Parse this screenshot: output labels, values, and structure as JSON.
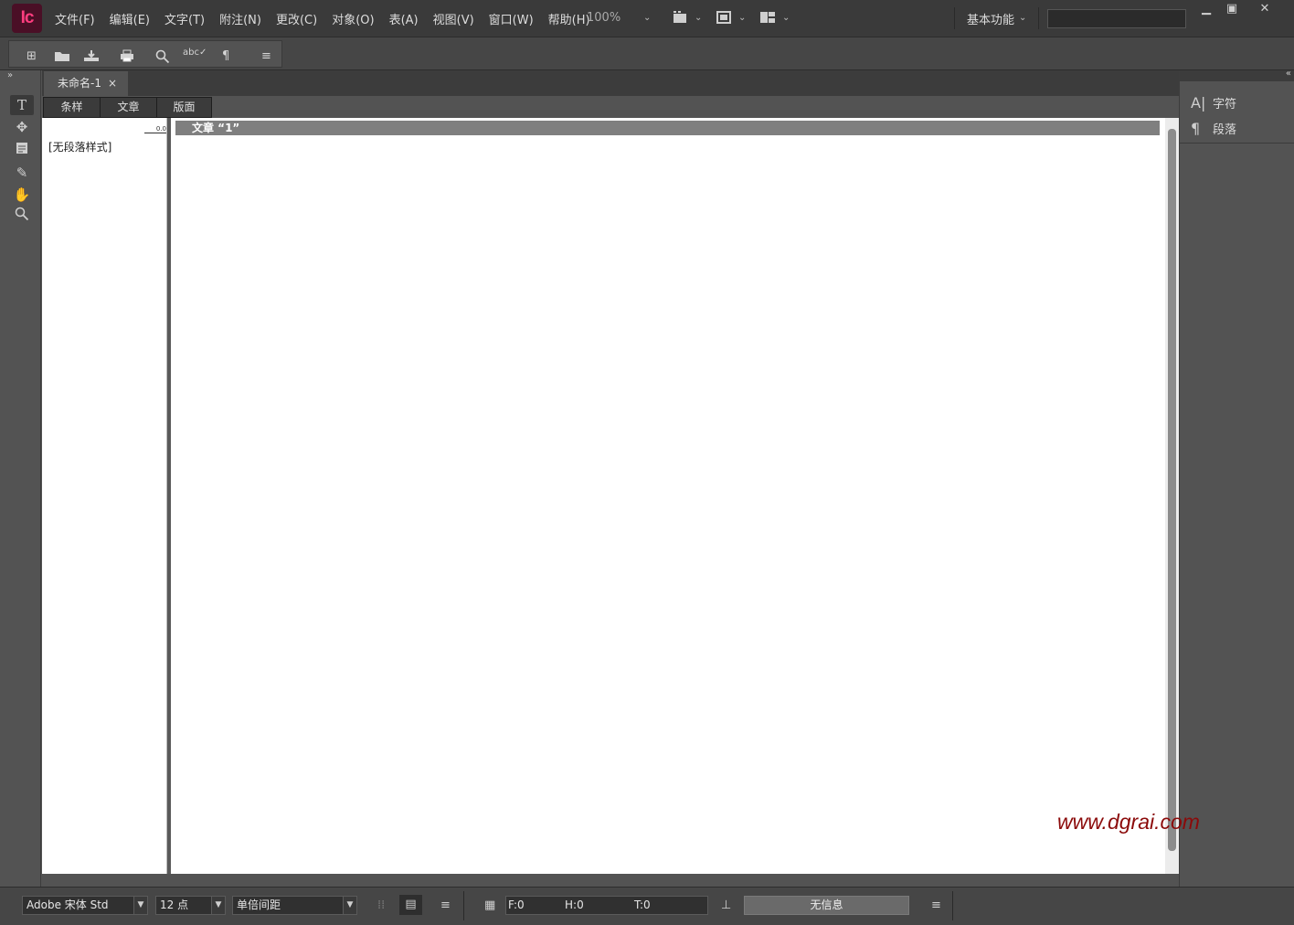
{
  "app": {
    "logo_text": "Ic",
    "accent": "#ff3d7f"
  },
  "menu": [
    "文件(F)",
    "编辑(E)",
    "文字(T)",
    "附注(N)",
    "更改(C)",
    "对象(O)",
    "表(A)",
    "视图(V)",
    "窗口(W)",
    "帮助(H)"
  ],
  "zoom": "100%",
  "workspace": "基本功能",
  "document": {
    "tab_title": "未命名-1",
    "close_glyph": "×"
  },
  "view_tabs": [
    "条样",
    "文章",
    "版面"
  ],
  "editor": {
    "ruler_value": "0.0",
    "paragraph_style": "[无段落样式]",
    "story_title": "文章 “1”"
  },
  "right_panel": {
    "items": [
      "字符",
      "段落"
    ]
  },
  "status": {
    "font": "Adobe 宋体 Std",
    "size": "12 点",
    "spacing": "单倍间距",
    "f": "F:0",
    "h": "H:0",
    "t": "T:0",
    "info": "无信息"
  },
  "watermark": "www.dgrai.com"
}
